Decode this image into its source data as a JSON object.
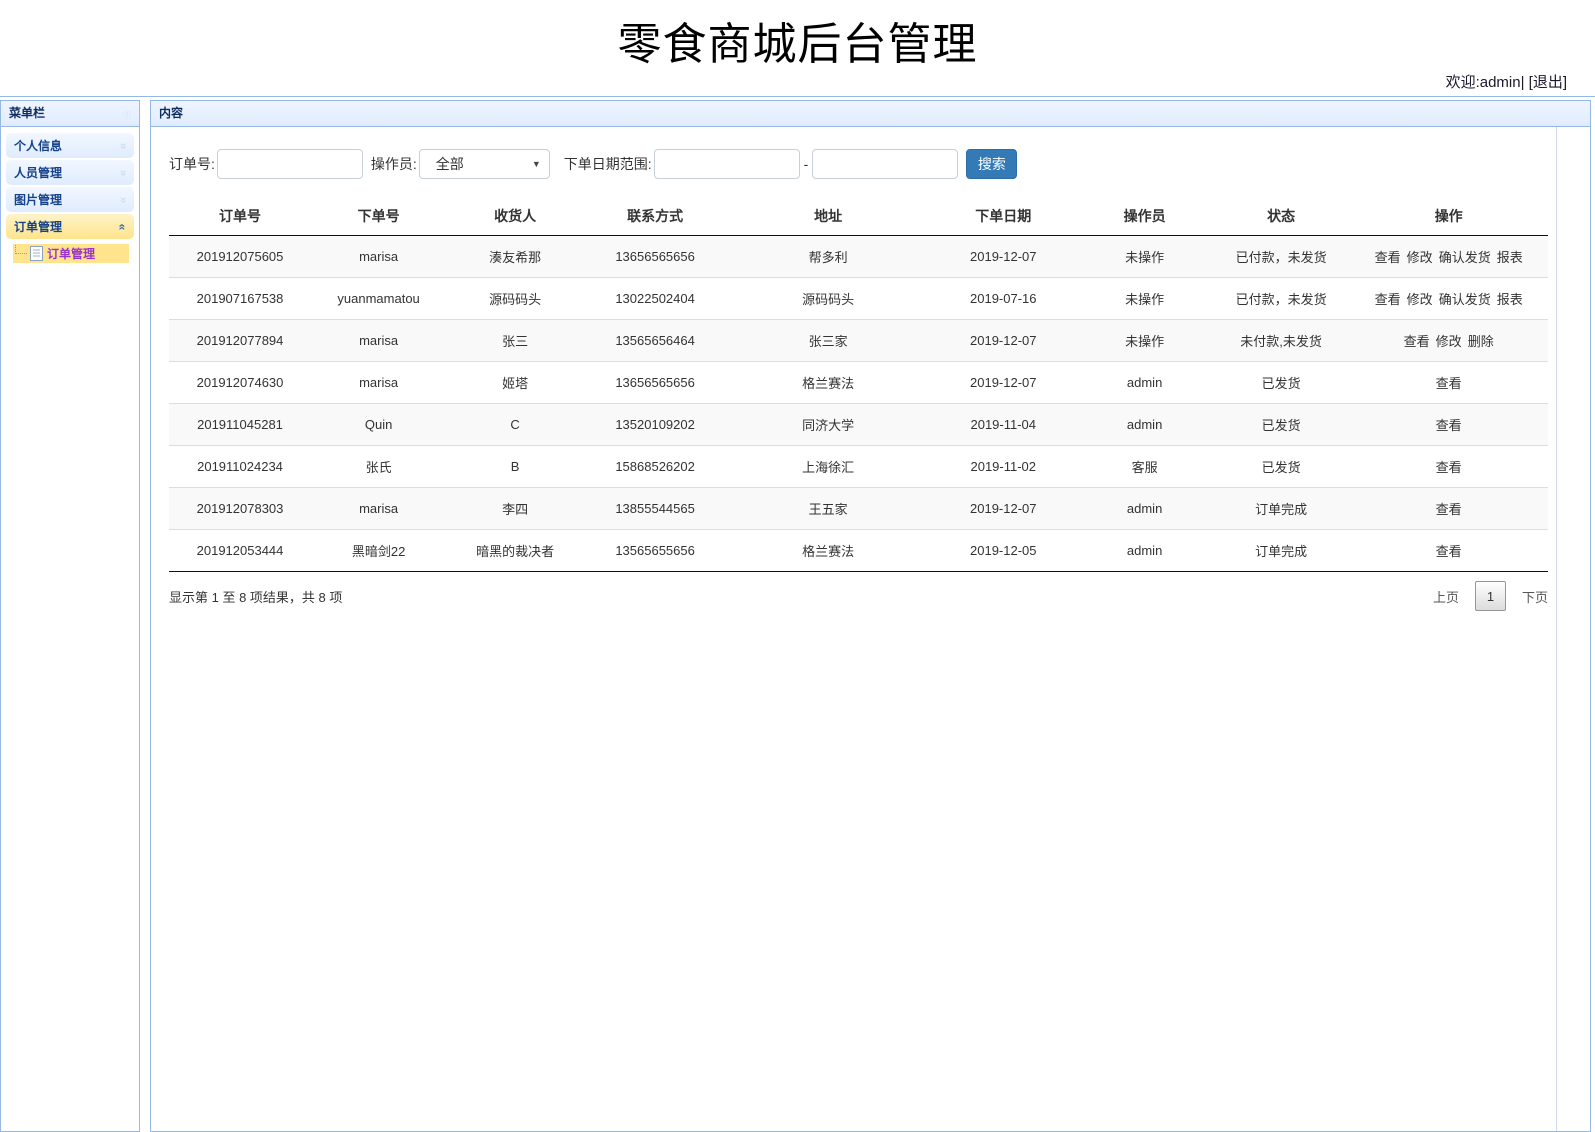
{
  "header": {
    "title": "零食商城后台管理",
    "welcome": "欢迎:admin|",
    "logout": "[退出]"
  },
  "icons": {
    "collapse": "«",
    "chevron": "«",
    "dropdown": "▼"
  },
  "sidebar": {
    "title": "菜单栏",
    "items": [
      {
        "label": "个人信息",
        "expanded": false,
        "selected": false
      },
      {
        "label": "人员管理",
        "expanded": false,
        "selected": false
      },
      {
        "label": "图片管理",
        "expanded": false,
        "selected": false
      },
      {
        "label": "订单管理",
        "expanded": true,
        "selected": true
      }
    ],
    "subitems": [
      {
        "label": "订单管理"
      }
    ]
  },
  "content": {
    "title": "内容",
    "search": {
      "order_no_label": "订单号:",
      "operator_label": "操作员:",
      "operator_value": "全部",
      "date_range_label": "下单日期范围:",
      "date_separator": "-",
      "search_button": "搜索"
    },
    "table": {
      "headers": [
        "订单号",
        "下单号",
        "收货人",
        "联系方式",
        "地址",
        "下单日期",
        "操作员",
        "状态",
        "操作"
      ],
      "rows": [
        {
          "order_id": "201912075605",
          "orderer": "marisa",
          "receiver": "湊友希那",
          "contact": "13656565656",
          "address": "帮多利",
          "date": "2019-12-07",
          "operator": "未操作",
          "status": "已付款，未发货",
          "actions": [
            "查看",
            "修改",
            "确认发货",
            "报表"
          ]
        },
        {
          "order_id": "201907167538",
          "orderer": "yuanmamatou",
          "receiver": "源码码头",
          "contact": "13022502404",
          "address": "源码码头",
          "date": "2019-07-16",
          "operator": "未操作",
          "status": "已付款，未发货",
          "actions": [
            "查看",
            "修改",
            "确认发货",
            "报表"
          ]
        },
        {
          "order_id": "201912077894",
          "orderer": "marisa",
          "receiver": "张三",
          "contact": "13565656464",
          "address": "张三家",
          "date": "2019-12-07",
          "operator": "未操作",
          "status": "未付款,未发货",
          "actions": [
            "查看",
            "修改",
            "删除"
          ]
        },
        {
          "order_id": "201912074630",
          "orderer": "marisa",
          "receiver": "姬塔",
          "contact": "13656565656",
          "address": "格兰赛法",
          "date": "2019-12-07",
          "operator": "admin",
          "status": "已发货",
          "actions": [
            "查看"
          ]
        },
        {
          "order_id": "201911045281",
          "orderer": "Quin",
          "receiver": "C",
          "contact": "13520109202",
          "address": "同济大学",
          "date": "2019-11-04",
          "operator": "admin",
          "status": "已发货",
          "actions": [
            "查看"
          ]
        },
        {
          "order_id": "201911024234",
          "orderer": "张氏",
          "receiver": "B",
          "contact": "15868526202",
          "address": "上海徐汇",
          "date": "2019-11-02",
          "operator": "客服",
          "status": "已发货",
          "actions": [
            "查看"
          ]
        },
        {
          "order_id": "201912078303",
          "orderer": "marisa",
          "receiver": "李四",
          "contact": "13855544565",
          "address": "王五家",
          "date": "2019-12-07",
          "operator": "admin",
          "status": "订单完成",
          "actions": [
            "查看"
          ]
        },
        {
          "order_id": "201912053444",
          "orderer": "黑暗剑22",
          "receiver": "暗黑的裁决者",
          "contact": "13565655656",
          "address": "格兰赛法",
          "date": "2019-12-05",
          "operator": "admin",
          "status": "订单完成",
          "actions": [
            "查看"
          ]
        }
      ]
    },
    "pagination": {
      "info": "显示第 1 至 8 项结果，共 8 项",
      "prev": "上页",
      "current": "1",
      "next": "下页"
    }
  },
  "colors": {
    "accent_blue": "#337ab7",
    "panel_border": "#95B8E7",
    "panel_header_top": "#EFF5FF",
    "panel_header_bottom": "#E0ECFF",
    "selected_yellow": "#FFE48D",
    "subitem_link_purple": "#9932cc",
    "stripe_gray": "#f9f9f9",
    "navy_text": "#0E2D5F"
  }
}
